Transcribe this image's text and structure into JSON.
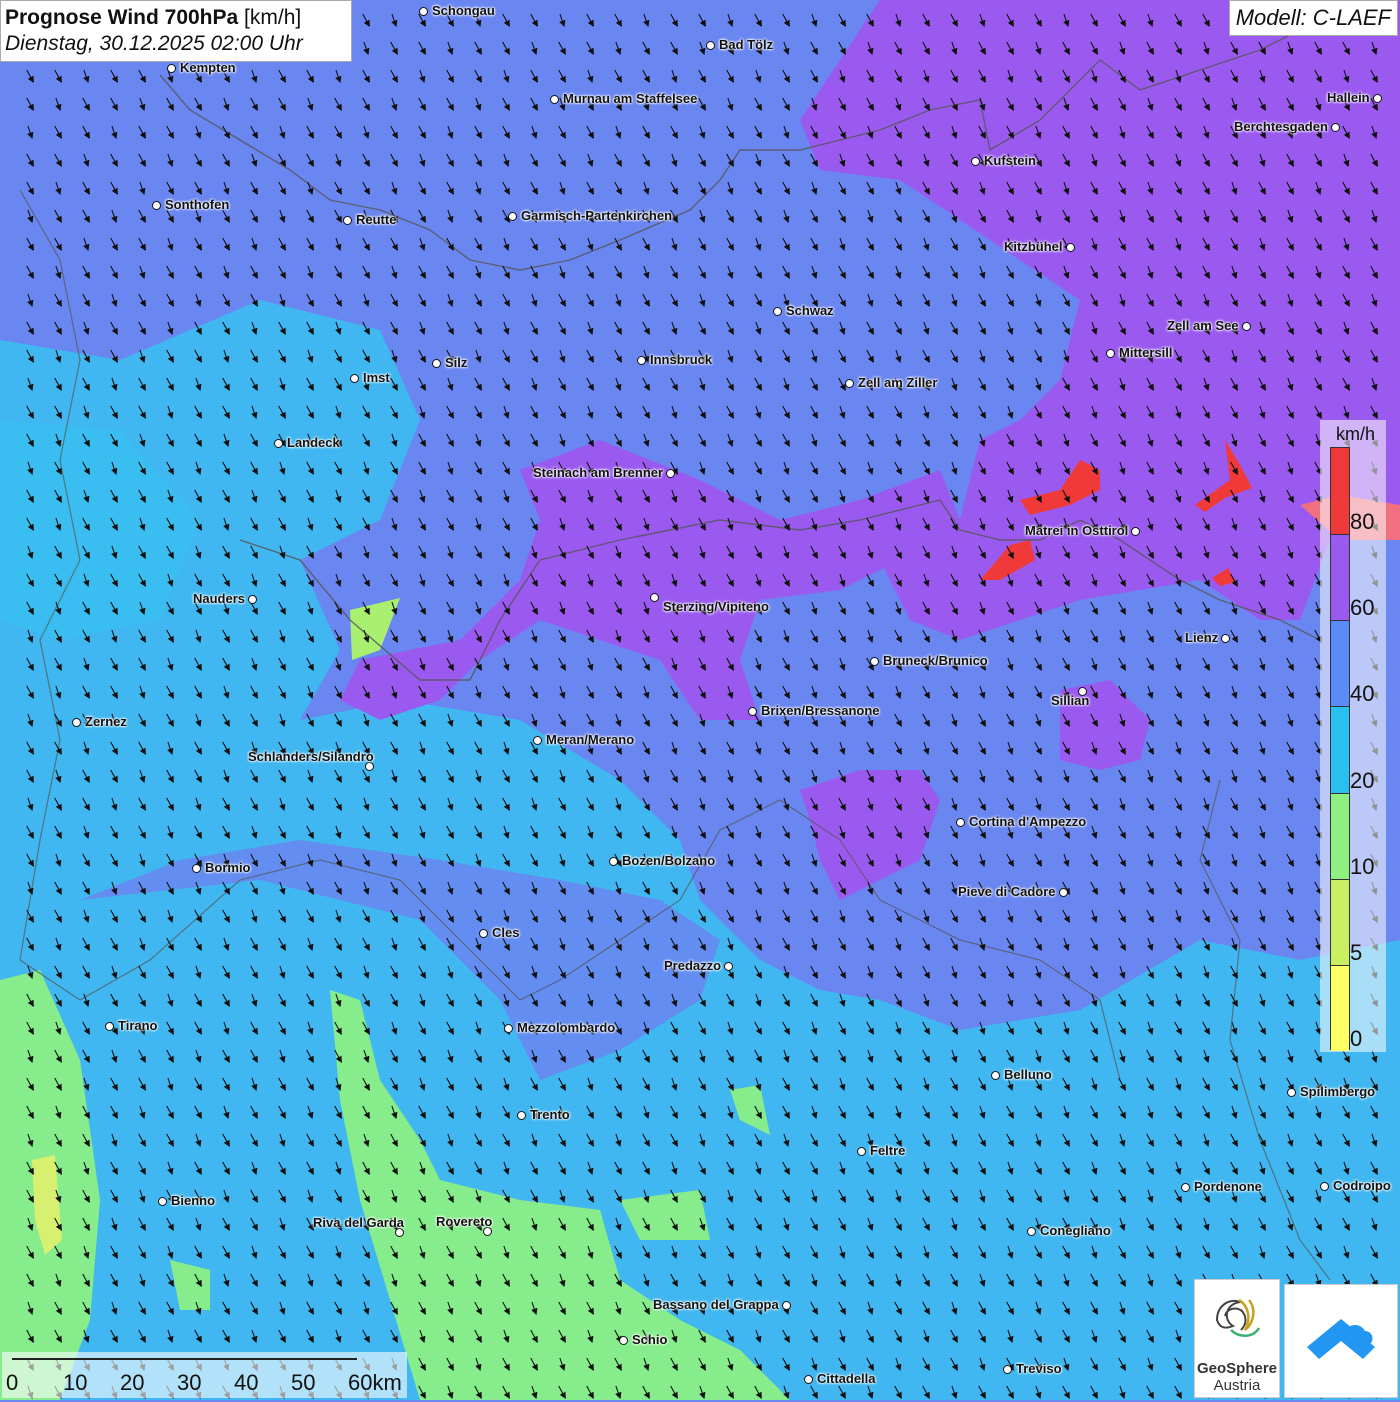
{
  "title": {
    "main": "Prognose Wind 700hPa",
    "unit": "[km/h]",
    "datetime": "Dienstag, 30.12.2025 02:00 Uhr"
  },
  "model_label": "Modell: C-LAEF",
  "legend": {
    "unit": "km/h",
    "ticks": [
      "0",
      "5",
      "10",
      "20",
      "40",
      "60",
      "80"
    ],
    "colors": [
      "#ffff66",
      "#c8f060",
      "#8ef080",
      "#28c0f0",
      "#5a8cf8",
      "#9a5af0",
      "#f03a3a"
    ]
  },
  "scale_bar": {
    "labels": [
      "0",
      "10",
      "20",
      "30",
      "40",
      "50",
      "60km"
    ]
  },
  "cities": [
    {
      "name": "Schongau"
    },
    {
      "name": "Bad Tölz"
    },
    {
      "name": "Kempten"
    },
    {
      "name": "Hallein"
    },
    {
      "name": "Murnau am Staffelsee"
    },
    {
      "name": "Berchtesgaden"
    },
    {
      "name": "Kufstein"
    },
    {
      "name": "Sonthofen"
    },
    {
      "name": "Reutte"
    },
    {
      "name": "Garmisch-Partenkirchen"
    },
    {
      "name": "Kitzbühel"
    },
    {
      "name": "Schwaz"
    },
    {
      "name": "Zell am See"
    },
    {
      "name": "Innsbruck"
    },
    {
      "name": "Silz"
    },
    {
      "name": "Mittersill"
    },
    {
      "name": "Imst"
    },
    {
      "name": "Zell am Ziller"
    },
    {
      "name": "Landeck"
    },
    {
      "name": "Steinach am Brenner"
    },
    {
      "name": "Matrei in Osttirol"
    },
    {
      "name": "Nauders"
    },
    {
      "name": "Sterzing/Vipiteno"
    },
    {
      "name": "Lienz"
    },
    {
      "name": "Bruneck/Brunico"
    },
    {
      "name": "Sillian"
    },
    {
      "name": "Brixen/Bressanone"
    },
    {
      "name": "Zernez"
    },
    {
      "name": "Meran/Merano"
    },
    {
      "name": "Schlanders/Silandro"
    },
    {
      "name": "Cortina d'Ampezzo"
    },
    {
      "name": "Bozen/Bolzano"
    },
    {
      "name": "Bormio"
    },
    {
      "name": "Pieve di Cadore"
    },
    {
      "name": "Cles"
    },
    {
      "name": "Predazzo"
    },
    {
      "name": "Tirano"
    },
    {
      "name": "Mezzolombardo"
    },
    {
      "name": "Belluno"
    },
    {
      "name": "Spilimbergo"
    },
    {
      "name": "Trento"
    },
    {
      "name": "Feltre"
    },
    {
      "name": "Bienno"
    },
    {
      "name": "Pordenone"
    },
    {
      "name": "Codroipo"
    },
    {
      "name": "Riva del Garda"
    },
    {
      "name": "Rovereto"
    },
    {
      "name": "Conegliano"
    },
    {
      "name": "Bassano del Grappa"
    },
    {
      "name": "Schio"
    },
    {
      "name": "Treviso"
    },
    {
      "name": "Cittadella"
    }
  ],
  "logos": {
    "geosphere_name": "GeoSphere",
    "geosphere_sub": "Austria"
  },
  "wind_direction": "north-west"
}
